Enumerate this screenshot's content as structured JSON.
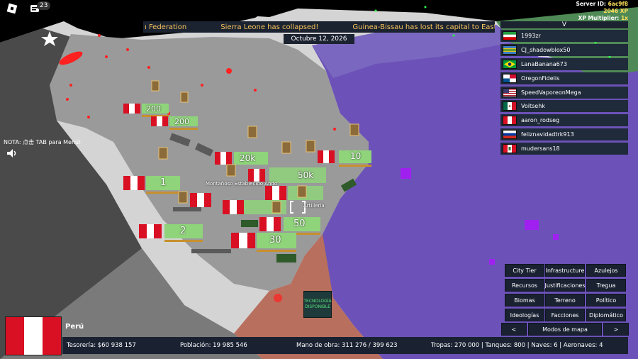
{
  "top_bar": {
    "notification_count": "23"
  },
  "server": {
    "id_label": "Server ID:",
    "id_value": "6ac9f8",
    "xp": "2046 XP",
    "multiplier_label": "XP Multiplier:",
    "multiplier_value": "1x"
  },
  "ticker": [
    "ı Federation",
    "Sierra Leone has collapsed!",
    "Guinea-Bissau has lost its capital to East African Federatic"
  ],
  "date": "Octubre 12, 2026",
  "player_list": {
    "header": "V",
    "players": [
      {
        "name": "1993zr",
        "flag": "iran"
      },
      {
        "name": "CJ_shadowblox50",
        "flag": "east-african-federation"
      },
      {
        "name": "LanaBanana673",
        "flag": "brazil"
      },
      {
        "name": "OregonFidelis",
        "flag": "panama"
      },
      {
        "name": "SpeedVaporeonMega",
        "flag": "usa"
      },
      {
        "name": "Voitsehk",
        "flag": "mexico"
      },
      {
        "name": "aaron_rodseg",
        "flag": "peru"
      },
      {
        "name": "feliznavidadtrk913",
        "flag": "russia"
      },
      {
        "name": "mudersans18",
        "flag": "peru-arms"
      }
    ]
  },
  "chat_hint": "NOTA: 点击 TAB para Menú!",
  "map_labels": {
    "label1": "Montañoso Establecido Ando",
    "label2": "Artillería"
  },
  "unit_counts": [
    "200",
    "200",
    "20k",
    "10",
    "50k",
    "1",
    "2",
    "50",
    "30"
  ],
  "menu": {
    "rows": [
      [
        "City Tier",
        "Infrastructure",
        "Azulejos"
      ],
      [
        "Recursos",
        "Justificaciones",
        "Tregua"
      ],
      [
        "Biomas",
        "Terreno",
        "Político"
      ],
      [
        "Ideologías",
        "Facciones",
        "Diplomático"
      ]
    ],
    "prev": "<",
    "map_modes": "Modos de mapa",
    "next": ">"
  },
  "tech_badge": "TECNOLOGÍA DISPONIBLE",
  "country": {
    "name": "Perú",
    "flag": "peru"
  },
  "stats": {
    "treasury": "Tesorería: $60 938 157",
    "population": "Población: 19 985 546",
    "manpower": "Mano de obra: 311 276 / 399 623",
    "forces": "Tropas: 270 000 | Tanques: 800 | Naves: 6 | Aeronaves: 4"
  },
  "colors": {
    "panel": "#1a2232",
    "ticker_text": "#f7c45c",
    "tech_text": "#56e07a",
    "peru_red": "#d91023"
  }
}
